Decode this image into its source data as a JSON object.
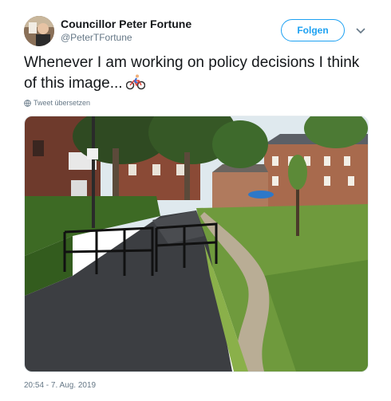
{
  "user": {
    "display_name": "Councillor Peter Fortune",
    "handle": "@PeterTFortune"
  },
  "follow_button": {
    "label": "Folgen",
    "color": "#1da1f2"
  },
  "tweet": {
    "text": "Whenever I am working on policy decisions I think of this image...",
    "emoji": "bicyclist-emoji",
    "translate_label": "Tweet übersetzen"
  },
  "photo": {
    "description_icon": "park-path-photo"
  },
  "timestamp": "20:54 - 7. Aug. 2019",
  "icons": {
    "avatar": "avatar-photo",
    "caret": "chevron-down-icon",
    "globe": "globe-icon"
  }
}
